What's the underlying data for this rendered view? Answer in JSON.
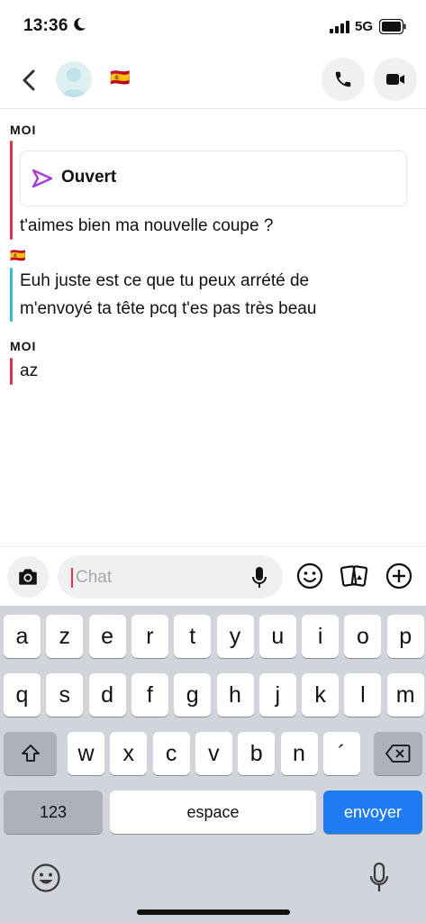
{
  "status_bar": {
    "time": "13:36",
    "network": "5G"
  },
  "header": {
    "contact_flag": "🇪🇸"
  },
  "messages": [
    {
      "sender": "MOI",
      "sender_color": "#e0334a",
      "snap_status": "Ouvert",
      "text": "t'aimes bien ma nouvelle coupe ?"
    },
    {
      "sender": "🇪🇸",
      "sender_color": "#3bb6d8",
      "lines": [
        "Euh juste est ce que tu peux arrété de",
        "m'envoyé ta tête pcq t'es pas très beau"
      ]
    },
    {
      "sender": "MOI",
      "sender_color": "#e0334a",
      "text": "az"
    }
  ],
  "composer": {
    "placeholder": "Chat"
  },
  "keyboard": {
    "row1": [
      "a",
      "z",
      "e",
      "r",
      "t",
      "y",
      "u",
      "i",
      "o",
      "p"
    ],
    "row2": [
      "q",
      "s",
      "d",
      "f",
      "g",
      "h",
      "j",
      "k",
      "l",
      "m"
    ],
    "row3": [
      "w",
      "x",
      "c",
      "v",
      "b",
      "n",
      "´"
    ],
    "numbers_label": "123",
    "space_label": "espace",
    "send_label": "envoyer"
  },
  "colors": {
    "accent_me": "#e0334a",
    "accent_friend": "#3bb6d8",
    "send_key": "#1f7bf2",
    "snap_icon": "#a53fd8"
  }
}
